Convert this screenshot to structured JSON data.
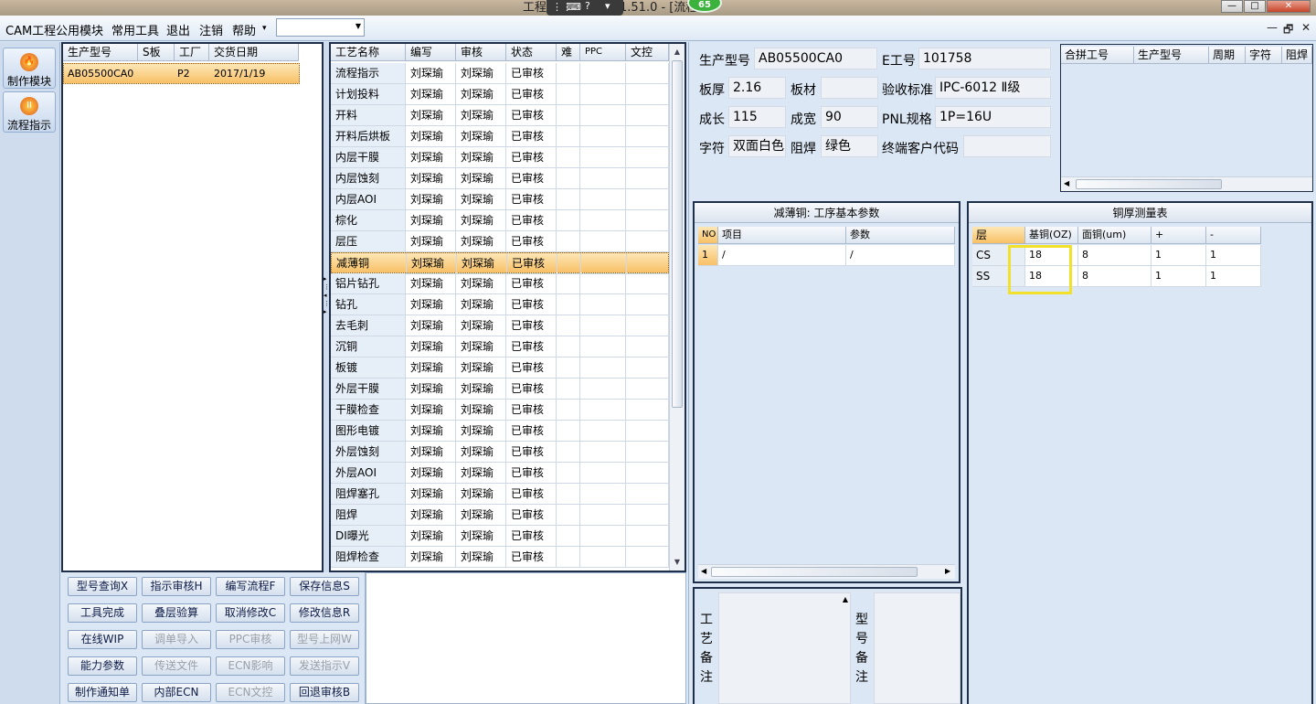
{
  "window": {
    "title_prefix": "工程",
    "title_suffix": "1.51.0 - [流程",
    "badge": "65",
    "btn_min": "—",
    "btn_max": "□",
    "btn_close": "✕"
  },
  "menu": {
    "items": [
      "CAM工程",
      "公用模块",
      "常用工具",
      "退出",
      "注销",
      "帮助"
    ],
    "help_arrow": "▾",
    "combo_value": "",
    "mdi_min": "—",
    "mdi_restore": "🗗",
    "mdi_close": "✕"
  },
  "sidebar": {
    "items": [
      {
        "label": "制作模块"
      },
      {
        "label": "流程指示"
      }
    ]
  },
  "order_list": {
    "headers": [
      "生产型号",
      "S板",
      "工厂",
      "交货日期"
    ],
    "rows": [
      [
        "AB05500CA0",
        "",
        "P2",
        "2017/1/19"
      ]
    ]
  },
  "process_list": {
    "headers": [
      "工艺名称",
      "编写",
      "审核",
      "状态",
      "难",
      "PPC",
      "文控"
    ],
    "rows": [
      [
        "流程指示",
        "刘琛瑜",
        "刘琛瑜",
        "已审核"
      ],
      [
        "计划投料",
        "刘琛瑜",
        "刘琛瑜",
        "已审核"
      ],
      [
        "开料",
        "刘琛瑜",
        "刘琛瑜",
        "已审核"
      ],
      [
        "开料后烘板",
        "刘琛瑜",
        "刘琛瑜",
        "已审核"
      ],
      [
        "内层干膜",
        "刘琛瑜",
        "刘琛瑜",
        "已审核"
      ],
      [
        "内层蚀刻",
        "刘琛瑜",
        "刘琛瑜",
        "已审核"
      ],
      [
        "内层AOI",
        "刘琛瑜",
        "刘琛瑜",
        "已审核"
      ],
      [
        "棕化",
        "刘琛瑜",
        "刘琛瑜",
        "已审核"
      ],
      [
        "层压",
        "刘琛瑜",
        "刘琛瑜",
        "已审核"
      ],
      [
        "减薄铜",
        "刘琛瑜",
        "刘琛瑜",
        "已审核"
      ],
      [
        "铝片钻孔",
        "刘琛瑜",
        "刘琛瑜",
        "已审核"
      ],
      [
        "钻孔",
        "刘琛瑜",
        "刘琛瑜",
        "已审核"
      ],
      [
        "去毛刺",
        "刘琛瑜",
        "刘琛瑜",
        "已审核"
      ],
      [
        "沉铜",
        "刘琛瑜",
        "刘琛瑜",
        "已审核"
      ],
      [
        "板镀",
        "刘琛瑜",
        "刘琛瑜",
        "已审核"
      ],
      [
        "外层干膜",
        "刘琛瑜",
        "刘琛瑜",
        "已审核"
      ],
      [
        "干膜检查",
        "刘琛瑜",
        "刘琛瑜",
        "已审核"
      ],
      [
        "图形电镀",
        "刘琛瑜",
        "刘琛瑜",
        "已审核"
      ],
      [
        "外层蚀刻",
        "刘琛瑜",
        "刘琛瑜",
        "已审核"
      ],
      [
        "外层AOI",
        "刘琛瑜",
        "刘琛瑜",
        "已审核"
      ],
      [
        "阻焊塞孔",
        "刘琛瑜",
        "刘琛瑜",
        "已审核"
      ],
      [
        "阻焊",
        "刘琛瑜",
        "刘琛瑜",
        "已审核"
      ],
      [
        "DI曝光",
        "刘琛瑜",
        "刘琛瑜",
        "已审核"
      ],
      [
        "阻焊检查",
        "刘琛瑜",
        "刘琛瑜",
        "已审核"
      ]
    ],
    "selected_index": 9
  },
  "buttons": {
    "rows": [
      [
        {
          "label": "型号查询X",
          "enabled": true
        },
        {
          "label": "指示审核H",
          "enabled": true
        },
        {
          "label": "编写流程F",
          "enabled": true
        },
        {
          "label": "保存信息S",
          "enabled": true
        }
      ],
      [
        {
          "label": "工具完成",
          "enabled": true
        },
        {
          "label": "叠层验算",
          "enabled": true
        },
        {
          "label": "取消修改C",
          "enabled": true
        },
        {
          "label": "修改信息R",
          "enabled": true
        }
      ],
      [
        {
          "label": "在线WIP",
          "enabled": true
        },
        {
          "label": "调单导入",
          "enabled": false
        },
        {
          "label": "PPC审核",
          "enabled": false
        },
        {
          "label": "型号上网W",
          "enabled": false
        }
      ],
      [
        {
          "label": "能力参数",
          "enabled": true
        },
        {
          "label": "传送文件",
          "enabled": false
        },
        {
          "label": "ECN影响",
          "enabled": false
        },
        {
          "label": "发送指示V",
          "enabled": false
        }
      ],
      [
        {
          "label": "制作通知单",
          "enabled": true
        },
        {
          "label": "内部ECN",
          "enabled": true
        },
        {
          "label": "ECN文控",
          "enabled": false
        },
        {
          "label": "回退审核B",
          "enabled": true
        }
      ]
    ]
  },
  "info": {
    "prod_model_label": "生产型号",
    "prod_model": "AB05500CA0",
    "e_no_label": "E工号",
    "e_no": "101758",
    "thickness_label": "板厚",
    "thickness": "2.16",
    "material_label": "板材",
    "material": "",
    "standard_label": "验收标准",
    "standard": "IPC-6012 Ⅱ级",
    "length_label": "成长",
    "length": "115",
    "width_label": "成宽",
    "width": "90",
    "pnl_label": "PNL规格",
    "pnl": "1P=16U",
    "legend_label": "字符",
    "legend": "双面白色",
    "mask_label": "阻焊",
    "mask": "绿色",
    "customer_label": "终端客户代码",
    "customer": ""
  },
  "merge_table": {
    "headers": [
      "合拼工号",
      "生产型号",
      "周期",
      "字符",
      "阻焊"
    ]
  },
  "thin_copper": {
    "title": "减薄铜: 工序基本参数",
    "headers": [
      "NO",
      "项目",
      "参数"
    ],
    "rows": [
      [
        "1",
        "/",
        "/"
      ]
    ]
  },
  "copper_table": {
    "title": "铜厚测量表",
    "headers": [
      "层",
      "基铜(OZ)",
      "面铜(um)",
      "+",
      "-"
    ],
    "rows": [
      [
        "CS",
        "18",
        "8",
        "1",
        "1"
      ],
      [
        "SS",
        "18",
        "8",
        "1",
        "1"
      ]
    ]
  },
  "notes": {
    "process_label": [
      "工",
      "艺",
      "备",
      "注"
    ],
    "model_label": [
      "型",
      "号",
      "备",
      "注"
    ]
  },
  "colors": {
    "accent_selected": "#f8c066",
    "highlight_box": "#f2e12a",
    "panel_border": "#1f2f49"
  }
}
